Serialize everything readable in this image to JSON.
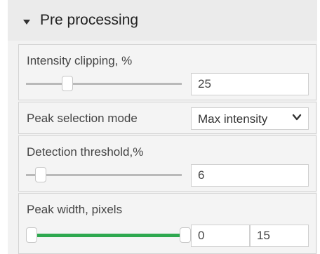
{
  "panel": {
    "title": "Pre processing",
    "intensity_clipping": {
      "label": "Intensity clipping, %",
      "value": "25",
      "slider_level": 0.25
    },
    "peak_selection": {
      "label": "Peak selection mode",
      "selected": "Max intensity"
    },
    "detection_threshold": {
      "label": "Detection threshold,%",
      "value": "6",
      "slider_level": 0.06
    },
    "peak_width": {
      "label": "Peak width, pixels",
      "min_value": "0",
      "max_value": "15",
      "range_low": 0,
      "range_high": 1
    }
  },
  "colors": {
    "range_fill": "#2ea84f",
    "track": "#b9b9b9"
  },
  "icons": [
    "caret-down-icon",
    "chevron-down-icon"
  ]
}
